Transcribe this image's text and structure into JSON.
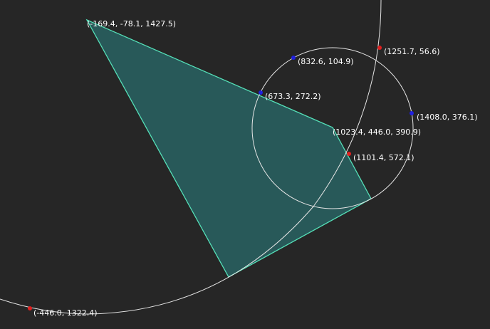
{
  "colors": {
    "background": "#262626",
    "polygon_fill": "#2a6e6e",
    "polygon_stroke": "#55e0b8",
    "circle_stroke": "#e6e6e6",
    "red_point": "#e02020",
    "blue_point": "#2020e0"
  },
  "labels": {
    "quad_top_left": "(-169.4, -78.1, 1427.5)",
    "quad_right_vertex": "(1023.4, 446.0, 390.9)",
    "circle_top": "(832.6, 104.9)",
    "circle_left": "(673.3, 272.2)",
    "circle_right": "(1408.0, 376.1)",
    "arc_top": "(1251.7, 56.6)",
    "arc_mid": "(1101.4, 572.1)",
    "arc_bottom": "(-446.0, 1322.4)"
  }
}
